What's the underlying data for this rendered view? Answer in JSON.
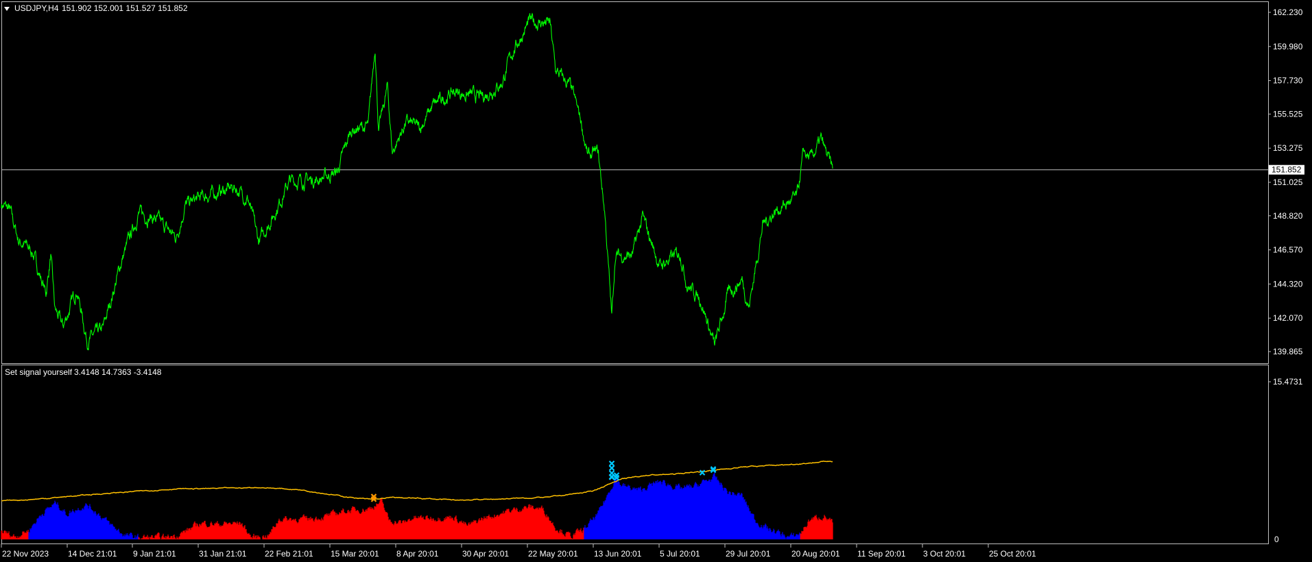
{
  "main_panel": {
    "symbol_label": "USDJPY,H4",
    "ohlc": "151.902 152.001 151.527 151.852",
    "current_price": "151.852",
    "price_labels": [
      "162.230",
      "159.980",
      "157.730",
      "155.525",
      "153.275",
      "151.025",
      "148.820",
      "146.570",
      "144.320",
      "142.070",
      "139.865"
    ],
    "line_color": "#00ff00"
  },
  "indicator_panel": {
    "title": "Set signal yourself",
    "values": "3.4148 14.7363 -3.4148",
    "top_label": "15.4731",
    "bottom_label": "0",
    "colors": {
      "bull": "#0000ff",
      "bear": "#ff0000",
      "signal_line": "#ffc000",
      "cross_up": "#00c8ff",
      "cross_down": "#ff9900"
    }
  },
  "time_axis": [
    "22 Nov 2023",
    "14 Dec 21:01",
    "9 Jan 21:01",
    "31 Jan 21:01",
    "22 Feb 21:01",
    "15 Mar 20:01",
    "8 Apr 20:01",
    "30 Apr 20:01",
    "22 May 20:01",
    "13 Jun 20:01",
    "5 Jul 20:01",
    "29 Jul 20:01",
    "20 Aug 20:01",
    "11 Sep 20:01",
    "3 Oct 20:01",
    "25 Oct 20:01"
  ],
  "chart_data": [
    {
      "type": "line",
      "symbol": "USDJPY,H4",
      "ylim": [
        139.865,
        162.23
      ],
      "x": [
        "22 Nov 2023",
        "14 Dec 21:01",
        "9 Jan 21:01",
        "31 Jan 21:01",
        "22 Feb 21:01",
        "15 Mar 20:01",
        "8 Apr 20:01",
        "30 Apr 20:01",
        "22 May 20:01",
        "13 Jun 20:01",
        "5 Jul 20:01",
        "29 Jul 20:01",
        "20 Aug 20:01",
        "11 Sep 20:01",
        "3 Oct 20:01",
        "25 Oct 20:01"
      ],
      "keypoints": [
        [
          0,
          149.6
        ],
        [
          12,
          149.2
        ],
        [
          25,
          147.2
        ],
        [
          45,
          146.5
        ],
        [
          65,
          143.7
        ],
        [
          72,
          146.2
        ],
        [
          78,
          142.6
        ],
        [
          90,
          141.5
        ],
        [
          110,
          144.0
        ],
        [
          125,
          140.6
        ],
        [
          148,
          141.3
        ],
        [
          175,
          145.8
        ],
        [
          200,
          149.0
        ],
        [
          225,
          148.6
        ],
        [
          255,
          147.4
        ],
        [
          268,
          149.5
        ],
        [
          290,
          150.0
        ],
        [
          340,
          150.7
        ],
        [
          360,
          149.9
        ],
        [
          375,
          147.1
        ],
        [
          395,
          148.7
        ],
        [
          420,
          151.1
        ],
        [
          460,
          151.2
        ],
        [
          490,
          151.7
        ],
        [
          510,
          154.5
        ],
        [
          535,
          154.7
        ],
        [
          545,
          160.1
        ],
        [
          550,
          154.4
        ],
        [
          563,
          157.3
        ],
        [
          570,
          153.0
        ],
        [
          590,
          155.0
        ],
        [
          610,
          154.6
        ],
        [
          630,
          156.1
        ],
        [
          660,
          157.0
        ],
        [
          700,
          156.6
        ],
        [
          730,
          157.6
        ],
        [
          745,
          159.6
        ],
        [
          770,
          161.6
        ],
        [
          800,
          161.5
        ],
        [
          808,
          158.4
        ],
        [
          830,
          157.3
        ],
        [
          845,
          155.1
        ],
        [
          855,
          152.7
        ],
        [
          870,
          153.0
        ],
        [
          880,
          149.0
        ],
        [
          890,
          142.1
        ],
        [
          895,
          146.2
        ],
        [
          920,
          146.2
        ],
        [
          935,
          148.7
        ],
        [
          960,
          145.5
        ],
        [
          990,
          146.4
        ],
        [
          1000,
          144.3
        ],
        [
          1020,
          143.3
        ],
        [
          1040,
          140.2
        ],
        [
          1060,
          143.7
        ],
        [
          1080,
          144.6
        ],
        [
          1090,
          142.8
        ],
        [
          1110,
          148.2
        ],
        [
          1130,
          149.2
        ],
        [
          1160,
          150.0
        ],
        [
          1170,
          153.0
        ],
        [
          1180,
          152.5
        ],
        [
          1195,
          153.8
        ],
        [
          1212,
          151.85
        ]
      ],
      "last_price": 151.852
    },
    {
      "type": "area",
      "indicator": "Set signal yourself",
      "ylim": [
        0,
        15.4731
      ],
      "buffer_values": [
        3.4148,
        14.7363,
        -3.4148
      ],
      "series": [
        {
          "name": "histogram",
          "keypoints": [
            [
              0,
              0.8,
              "r"
            ],
            [
              20,
              0.3,
              "r"
            ],
            [
              40,
              0.9,
              "b"
            ],
            [
              60,
              2.6,
              "b"
            ],
            [
              80,
              3.6,
              "b"
            ],
            [
              95,
              2.5,
              "b"
            ],
            [
              110,
              3.0,
              "b"
            ],
            [
              125,
              3.4,
              "b"
            ],
            [
              140,
              2.6,
              "b"
            ],
            [
              160,
              1.4,
              "b"
            ],
            [
              180,
              0.4,
              "b"
            ],
            [
              200,
              0.2,
              "r"
            ],
            [
              240,
              0.2,
              "r"
            ],
            [
              260,
              0.5,
              "r"
            ],
            [
              290,
              1.6,
              "r"
            ],
            [
              320,
              1.5,
              "r"
            ],
            [
              350,
              1.6,
              "r"
            ],
            [
              365,
              0.2,
              "r"
            ],
            [
              390,
              0.4,
              "r"
            ],
            [
              405,
              2.0,
              "r"
            ],
            [
              440,
              2.0,
              "r"
            ],
            [
              470,
              2.2,
              "r"
            ],
            [
              500,
              2.8,
              "r"
            ],
            [
              535,
              3.0,
              "r"
            ],
            [
              555,
              3.7,
              "r"
            ],
            [
              565,
              1.9,
              "r"
            ],
            [
              585,
              1.6,
              "r"
            ],
            [
              600,
              2.1,
              "r"
            ],
            [
              630,
              2.1,
              "r"
            ],
            [
              660,
              2.2,
              "r"
            ],
            [
              680,
              1.3,
              "r"
            ],
            [
              700,
              2.0,
              "r"
            ],
            [
              740,
              2.8,
              "r"
            ],
            [
              770,
              3.2,
              "r"
            ],
            [
              790,
              3.0,
              "r"
            ],
            [
              808,
              1.2,
              "r"
            ],
            [
              830,
              0.3,
              "r"
            ],
            [
              850,
              1.0,
              "b"
            ],
            [
              870,
              2.5,
              "b"
            ],
            [
              885,
              4.5,
              "b"
            ],
            [
              895,
              6.0,
              "b"
            ],
            [
              905,
              5.3,
              "b"
            ],
            [
              930,
              4.8,
              "b"
            ],
            [
              960,
              5.7,
              "b"
            ],
            [
              990,
              5.0,
              "b"
            ],
            [
              1010,
              5.2,
              "b"
            ],
            [
              1040,
              6.1,
              "b"
            ],
            [
              1060,
              4.6,
              "b"
            ],
            [
              1080,
              4.3,
              "b"
            ],
            [
              1100,
              1.8,
              "b"
            ],
            [
              1120,
              1.0,
              "b"
            ],
            [
              1150,
              0.2,
              "b"
            ],
            [
              1165,
              0.6,
              "r"
            ],
            [
              1180,
              2.0,
              "r"
            ],
            [
              1200,
              2.3,
              "r"
            ],
            [
              1212,
              1.6,
              "r"
            ]
          ]
        },
        {
          "name": "signal line",
          "keypoints": [
            [
              0,
              3.75
            ],
            [
              60,
              4.0
            ],
            [
              150,
              4.5
            ],
            [
              250,
              4.95
            ],
            [
              320,
              5.0
            ],
            [
              380,
              5.1
            ],
            [
              440,
              4.85
            ],
            [
              500,
              4.2
            ],
            [
              540,
              3.9
            ],
            [
              570,
              4.1
            ],
            [
              620,
              4.0
            ],
            [
              660,
              3.85
            ],
            [
              720,
              3.95
            ],
            [
              800,
              4.15
            ],
            [
              860,
              4.7
            ],
            [
              880,
              5.25
            ],
            [
              900,
              5.85
            ],
            [
              940,
              6.3
            ],
            [
              980,
              6.4
            ],
            [
              1040,
              6.8
            ],
            [
              1080,
              7.1
            ],
            [
              1150,
              7.35
            ],
            [
              1212,
              7.7
            ]
          ]
        }
      ],
      "markers": [
        {
          "x": 543,
          "values": [
            4.2,
            3.95
          ],
          "color": "orange"
        },
        {
          "x": 890,
          "values": [
            7.45,
            7.0,
            6.5,
            6.1,
            6.15
          ],
          "color": "cyan"
        },
        {
          "x": 897,
          "values": [
            6.05,
            6.3
          ],
          "color": "cyan"
        },
        {
          "x": 1022,
          "values": [
            6.55
          ],
          "color": "cyan"
        },
        {
          "x": 1038,
          "values": [
            6.9,
            6.8
          ],
          "color": "cyan"
        }
      ]
    }
  ]
}
